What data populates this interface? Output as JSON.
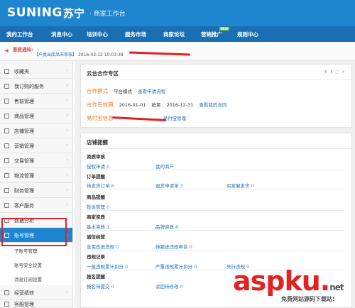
{
  "brand": {
    "logo": "SUNING",
    "logo_cn": "苏宁",
    "subtitle": "· 商家工作台"
  },
  "nav": [
    "我的工作台",
    "消息中心",
    "培训中心",
    "服务市场",
    "商家论坛",
    "营销推广",
    "规则中心"
  ],
  "nav_badge": "NEW",
  "notice": {
    "label": "重要通知:",
    "text": "【户类出库品未审核】",
    "time": "2016-03-12 10:03:38"
  },
  "sidebar": {
    "items": [
      "收藏夹",
      "我订购的服务",
      "售前管理",
      "商品管理",
      "店铺管理",
      "营销管理",
      "交易管理",
      "物流管理",
      "财务管理",
      "客户服务",
      "数据分析",
      "账号管理",
      "经营绩效",
      "客服管理"
    ],
    "active": "账号管理",
    "sub_items": [
      "子账号管理",
      "账号安全设置",
      "消息订阅设置"
    ]
  },
  "cloud_panel": {
    "title": "云台合作专区",
    "mode_label": "合作模式",
    "mode_value": "平台模式",
    "mode_link": "查看申请流程",
    "period_label": "合作有效期",
    "period_start": "2016-01-01",
    "period_to": "抵至",
    "period_end": "2016-12-31",
    "period_link": "查看我的合同",
    "pay_label": "易付宝信息",
    "pay_link": "易付宝管理"
  },
  "store_panel": {
    "title": "店铺提醒",
    "sections": [
      {
        "title": "资质审核",
        "stats": [
          {
            "label": "授权申请",
            "value": "0"
          },
          {
            "label": "我的商户",
            "value": ""
          }
        ]
      },
      {
        "title": "订单提醒",
        "stats": [
          {
            "label": "待发货订单",
            "value": "6"
          },
          {
            "label": "退货申请单",
            "value": "3"
          },
          {
            "label": "买家催发货",
            "value": "0"
          }
        ]
      },
      {
        "title": "商品提醒",
        "stats": [
          {
            "label": "投诉管理",
            "value": "0"
          }
        ]
      },
      {
        "title": "商家资质",
        "stats": [
          {
            "label": "基本资质",
            "value": "1"
          },
          {
            "label": "品牌资质",
            "value": "6"
          }
        ]
      },
      {
        "title": "诚信经营",
        "stats": [
          {
            "label": "急需改进违规",
            "value": "0"
          },
          {
            "label": "待跟进违规申诉",
            "value": "0"
          }
        ]
      },
      {
        "title": "违规记录",
        "stats": [
          {
            "label": "一般违规累计扣分",
            "value": "0"
          },
          {
            "label": "严重违规累计扣分",
            "value": "0"
          },
          {
            "label": "失行违规",
            "value": "0"
          }
        ]
      },
      {
        "title": "报名提醒",
        "stats": [
          {
            "label": "报名待提交",
            "value": "0"
          },
          {
            "label": "驳回待修改",
            "value": "0"
          }
        ]
      }
    ]
  },
  "watermark": {
    "main": "aspku",
    "dot": ".",
    "net": "net",
    "sub": "免费网站源码下载站!"
  },
  "colors": {
    "brand_blue": "#1e86cf",
    "nav_blue": "#1a6fb3",
    "accent_orange": "#e67e22",
    "highlight_red": "#d9232d"
  }
}
